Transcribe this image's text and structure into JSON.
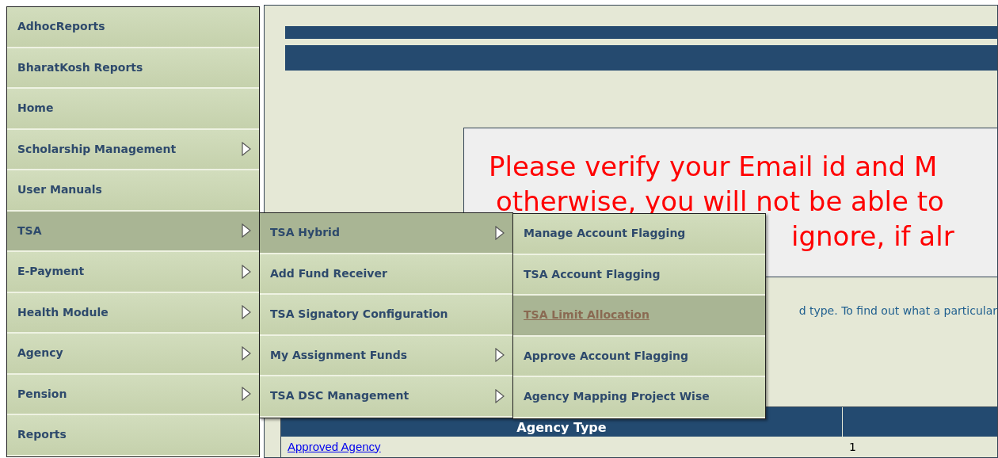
{
  "menu": {
    "items": [
      {
        "label": "AdhocReports",
        "has_submenu": false,
        "selected": false
      },
      {
        "label": "BharatKosh Reports",
        "has_submenu": false,
        "selected": false
      },
      {
        "label": "Home",
        "has_submenu": false,
        "selected": false
      },
      {
        "label": "Scholarship Management",
        "has_submenu": true,
        "selected": false
      },
      {
        "label": "User Manuals",
        "has_submenu": false,
        "selected": false
      },
      {
        "label": "TSA",
        "has_submenu": true,
        "selected": true
      },
      {
        "label": "E-Payment",
        "has_submenu": true,
        "selected": false
      },
      {
        "label": "Health Module",
        "has_submenu": true,
        "selected": false
      },
      {
        "label": "Agency",
        "has_submenu": true,
        "selected": false
      },
      {
        "label": "Pension",
        "has_submenu": true,
        "selected": false
      },
      {
        "label": "Reports",
        "has_submenu": false,
        "selected": false
      }
    ]
  },
  "submenu": {
    "items": [
      {
        "label": "TSA Hybrid",
        "has_submenu": true,
        "selected": true
      },
      {
        "label": "Add Fund Receiver",
        "has_submenu": false,
        "selected": false
      },
      {
        "label": "TSA Signatory Configuration",
        "has_submenu": false,
        "selected": false
      },
      {
        "label": "My Assignment Funds",
        "has_submenu": true,
        "selected": false
      },
      {
        "label": "TSA DSC Management",
        "has_submenu": true,
        "selected": false
      }
    ]
  },
  "submenu_2": {
    "items": [
      {
        "label": "Manage Account Flagging",
        "has_submenu": false,
        "selected": false
      },
      {
        "label": "TSA Account Flagging",
        "has_submenu": false,
        "selected": false
      },
      {
        "label": "TSA Limit Allocation",
        "has_submenu": false,
        "selected": true
      },
      {
        "label": "Approve Account Flagging",
        "has_submenu": false,
        "selected": false
      },
      {
        "label": "Agency Mapping Project Wise",
        "has_submenu": false,
        "selected": false
      }
    ]
  },
  "notice": {
    "lines": [
      "Please verify your Email id and M",
      "otherwise, you will not be able to",
      "ignore, if alr"
    ]
  },
  "help_text": "d type. To find out what a particular",
  "table": {
    "columns": [
      "Agency Type"
    ],
    "rows": [
      {
        "cells": [
          "Approved Agency",
          "1"
        ]
      }
    ]
  }
}
